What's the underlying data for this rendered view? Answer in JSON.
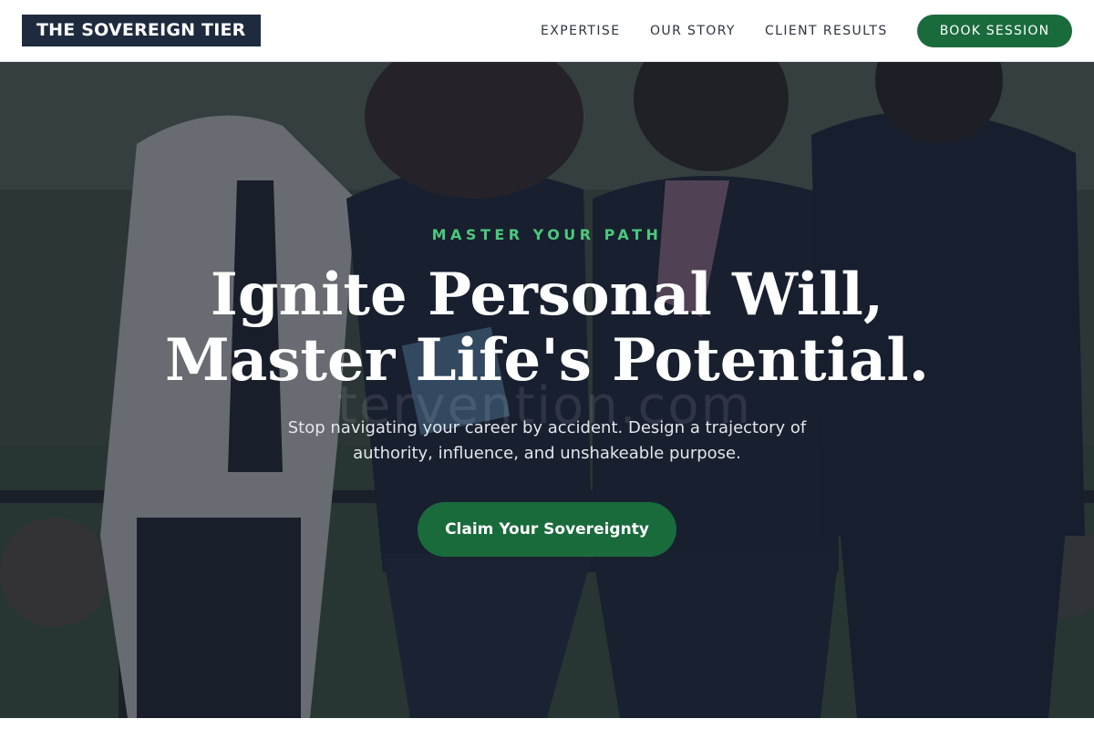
{
  "header": {
    "logo_text": "THE SOVEREIGN TIER",
    "nav": [
      {
        "label": "EXPERTISE"
      },
      {
        "label": "OUR STORY"
      },
      {
        "label": "CLIENT RESULTS"
      }
    ],
    "cta_label": "BOOK SESSION"
  },
  "hero": {
    "eyebrow": "MASTER YOUR PATH",
    "headline_line1": "Ignite Personal Will,",
    "headline_line2": "Master Life's Potential.",
    "subtext": "Stop navigating your career by accident. Design a trajectory of authority, influence, and unshakeable purpose.",
    "cta_label": "Claim Your Sovereignty",
    "watermark": "tervention.com",
    "background_image": "group-of-businesswomen-photo"
  },
  "colors": {
    "brand_dark": "#1e2a3e",
    "accent_green": "#1a6b3c",
    "eyebrow_green": "#4bc97b"
  }
}
